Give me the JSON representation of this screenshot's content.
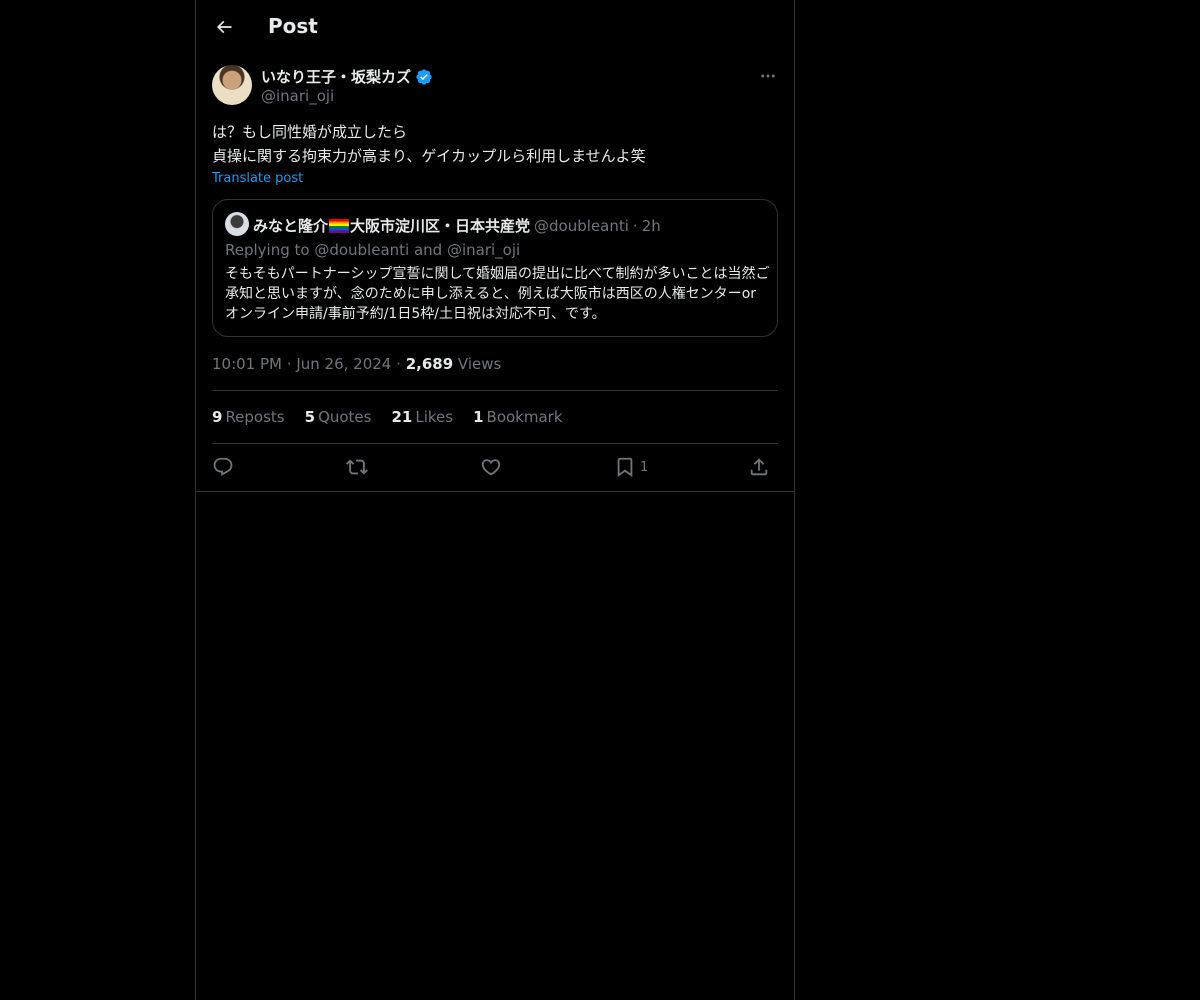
{
  "header": {
    "title": "Post"
  },
  "author": {
    "name": "いなり王子・坂梨カズ",
    "handle": "@inari_oji",
    "verified_color": "#1d9bf0"
  },
  "post": {
    "line1": "は？もし同性婚が成立したら",
    "line2": "貞操に関する拘束力が高まり、ゲイカップルら利用しませんよ笑",
    "translate_label": "Translate post"
  },
  "quote": {
    "name_part1": "みなと隆介",
    "name_part2": "大阪市淀川区・日本共産党",
    "handle": "@doubleanti",
    "separator": "·",
    "time": "2h",
    "replying": "Replying to @doubleanti and @inari_oji",
    "text": "そもそもパートナーシップ宣誓に関して婚姻届の提出に比べて制約が多いことは当然ご承知と思いますが、念のために申し添えると、例えば大阪市は西区の人権センターorオンライン申請/事前予約/1日5枠/土日祝は対応不可、です。"
  },
  "meta": {
    "time": "10:01 PM",
    "sep1": "·",
    "date": "Jun 26, 2024",
    "sep2": "·",
    "views_count": "2,689",
    "views_label": "Views"
  },
  "stats": {
    "reposts_count": "9",
    "reposts_label": "Reposts",
    "quotes_count": "5",
    "quotes_label": "Quotes",
    "likes_count": "21",
    "likes_label": "Likes",
    "bookmarks_count": "1",
    "bookmarks_label": "Bookmark"
  },
  "actions": {
    "reply_icon": "reply-icon",
    "repost_icon": "repost-icon",
    "like_icon": "heart-icon",
    "bookmark_icon": "bookmark-icon",
    "bookmark_count": "1",
    "share_icon": "share-icon"
  },
  "colors": {
    "background": "#000000",
    "text": "#e7e9ea",
    "secondary": "#71767b",
    "accent": "#1d9bf0",
    "border": "#2f3336"
  }
}
